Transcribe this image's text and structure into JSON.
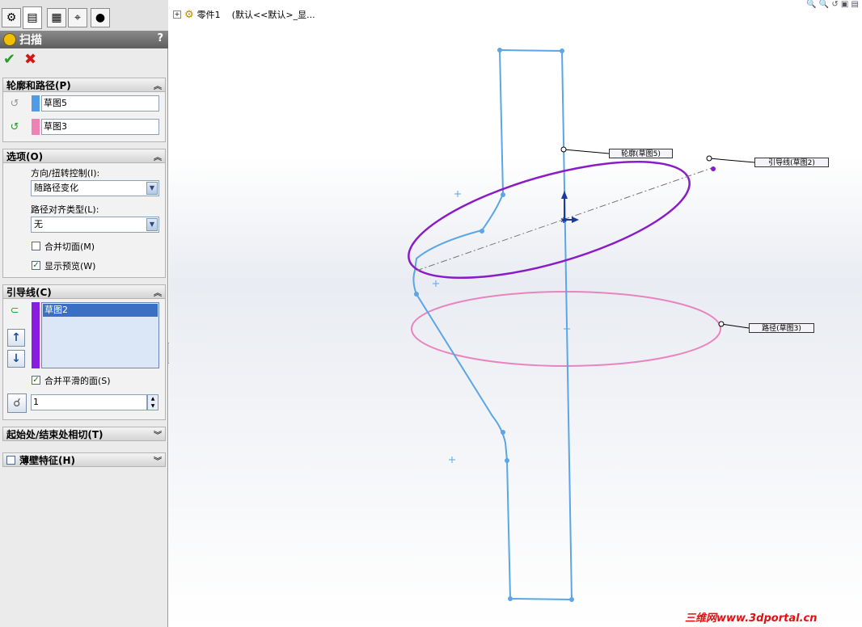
{
  "feature_manager": {
    "tabs": [
      {
        "icon": "part-icon"
      },
      {
        "icon": "property-icon"
      },
      {
        "icon": "config-icon"
      },
      {
        "icon": "dimxpert-icon"
      },
      {
        "icon": "display-icon"
      }
    ]
  },
  "panel": {
    "title": "扫描",
    "help": "?",
    "ok_icon": "check-icon",
    "cancel_icon": "close-icon"
  },
  "profile_path": {
    "header": "轮廓和路径(P)",
    "profile_value": "草图5",
    "path_value": "草图3",
    "profile_color": "#4f9be8",
    "path_color": "#ee82b4"
  },
  "options": {
    "header": "选项(O)",
    "orientation_label": "方向/扭转控制(I):",
    "orientation_value": "随路径变化",
    "alignment_label": "路径对齐类型(L):",
    "alignment_value": "无",
    "merge_tangent_label": "合并切面(M)",
    "merge_tangent_checked": false,
    "show_preview_label": "显示预览(W)",
    "show_preview_checked": true
  },
  "guide_curves": {
    "header": "引导线(C)",
    "items": [
      "草图2"
    ],
    "swatch_color": "#8a1be0",
    "merge_smooth_label": "合并平滑的面(S)",
    "merge_smooth_checked": true,
    "count_value": "1"
  },
  "tangency": {
    "header": "起始处/结束处相切(T)"
  },
  "thin_feature": {
    "header": "薄壁特征(H)",
    "checked": false
  },
  "tree": {
    "part_label": "零件1",
    "config_label": "(默认<<默认>_显..."
  },
  "callouts": {
    "profile": "轮廓(草图5)",
    "guide": "引导线(草图2)",
    "path": "路径(草图3)"
  },
  "watermark": "三维网www.3dportal.cn",
  "colors": {
    "sketch_blue": "#5aa6e6",
    "profile_purple": "#8a1bc8",
    "path_pink": "#e884bf"
  }
}
